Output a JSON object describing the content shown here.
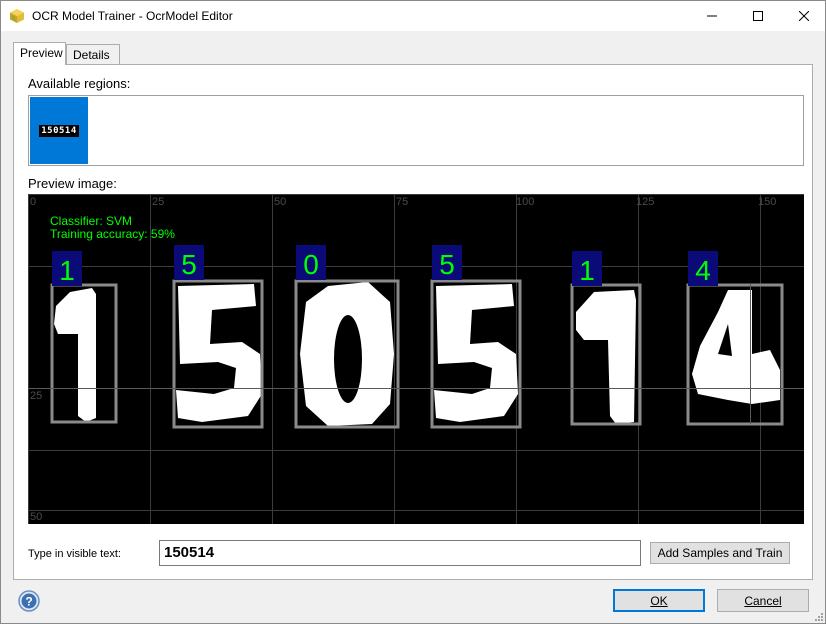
{
  "window": {
    "title": "OCR Model Trainer - OcrModel Editor"
  },
  "tabs": [
    {
      "label": "Preview",
      "active": true
    },
    {
      "label": "Details",
      "active": false
    }
  ],
  "preview_tab": {
    "available_regions_label": "Available regions:",
    "region_thumb_text": "150514",
    "preview_image_label": "Preview image:",
    "classifier_text": "Classifier: SVM",
    "accuracy_text": "Training accuracy: 59%",
    "ruler_x": [
      "0",
      "25",
      "50",
      "75",
      "100",
      "125",
      "150"
    ],
    "ruler_y": [
      "0",
      "25",
      "50"
    ],
    "characters": [
      "1",
      "5",
      "0",
      "5",
      "1",
      "4"
    ],
    "visible_text_label": "Type in visible text:",
    "visible_text_value": "150514",
    "add_samples_button": "Add Samples and Train"
  },
  "footer": {
    "ok_label": "OK",
    "cancel_label": "Cancel"
  },
  "colors": {
    "accent": "#0078d7",
    "overlay_text": "#00ff00",
    "char_label_bg": "#0a0a78",
    "box_border": "#808080"
  }
}
